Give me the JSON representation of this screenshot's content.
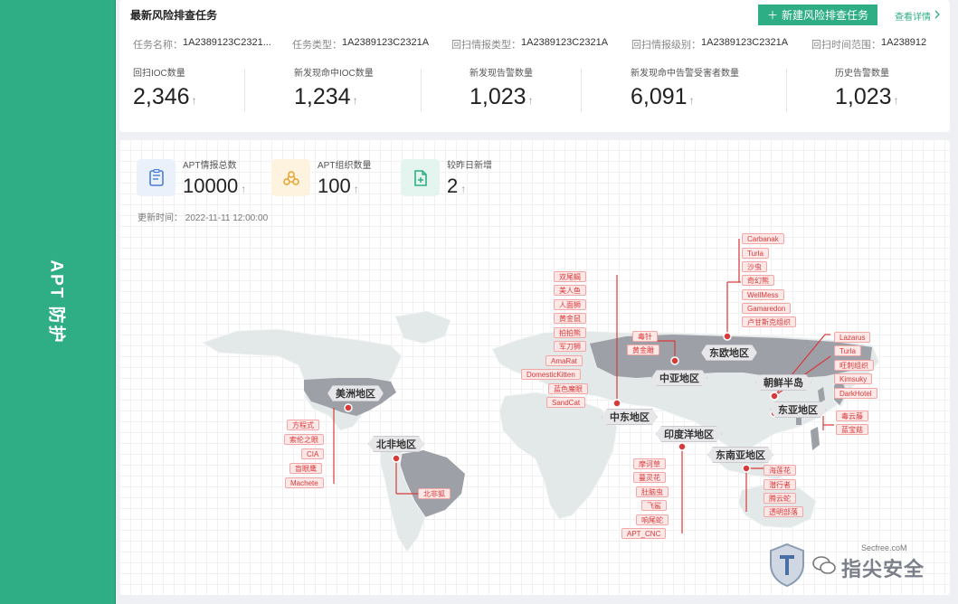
{
  "sidebar": {
    "title": "APT 防护"
  },
  "header": {
    "title": "最新风险排查任务",
    "new_task_button": "新建风险排查任务",
    "detail_link": "查看详情"
  },
  "meta": [
    {
      "k": "任务名称：",
      "v": "1A2389123C2321..."
    },
    {
      "k": "任务类型：",
      "v": "1A2389123C2321A"
    },
    {
      "k": "回扫情报类型：",
      "v": "1A2389123C2321A"
    },
    {
      "k": "回扫情报级别：",
      "v": "1A2389123C2321A"
    },
    {
      "k": "回扫时间范围：",
      "v": "1A238912"
    }
  ],
  "stats": [
    {
      "label": "回扫IOC数量",
      "value": "2,346"
    },
    {
      "label": "新发现命中IOC数量",
      "value": "1,234"
    },
    {
      "label": "新发现告警数量",
      "value": "1,023"
    },
    {
      "label": "新发现命中告警受害者数量",
      "value": "6,091"
    },
    {
      "label": "历史告警数量",
      "value": "1,023"
    }
  ],
  "kpis": [
    {
      "label": "APT情报总数",
      "value": "10000",
      "icon": "document-icon",
      "bg": "#eaf1fb",
      "color": "#4a7fd6"
    },
    {
      "label": "APT组织数量",
      "value": "100",
      "icon": "organization-icon",
      "bg": "#fdf3df",
      "color": "#e8a227"
    },
    {
      "label": "较昨日新增",
      "value": "2",
      "icon": "new-file-icon",
      "bg": "#e3f5ee",
      "color": "#2fae86"
    }
  ],
  "update_time": "更新时间：  2022-11-11   12:00:00",
  "arrow_glyph": "↑",
  "regions": {
    "americas": "美洲地区",
    "north_africa": "北非地区",
    "middle_east": "中东地区",
    "central_asia": "中亚地区",
    "eastern_europe": "东欧地区",
    "korea": "朝鲜半岛",
    "east_asia": "东亚地区",
    "indian_ocean": "印度洋地区",
    "southeast_asia": "东南亚地区"
  },
  "tags": {
    "americas": [
      "方程式",
      "索伦之眼",
      "CIA",
      "盲眼鹰",
      "Machete"
    ],
    "north_africa": [
      "北非狐"
    ],
    "middle_east": [
      "双尾蝎",
      "美人鱼",
      "人面狮",
      "黄金鼠",
      "拍拍熊",
      "军刀狮",
      "AmaRat",
      "DomesticKitten",
      "蓝色魔眼",
      "SandCat"
    ],
    "central_asia": [
      "毒针",
      "黄金雕"
    ],
    "eastern_europe": [
      "Carbanak",
      "Turla",
      "沙虫",
      "奇幻熊",
      "WellMess",
      "Gamaredon",
      "卢甘斯克组织"
    ],
    "korea": [
      "Lazarus",
      "Turla",
      "旺刺组织",
      "Kimsuky",
      "DarkHotel"
    ],
    "east_asia": [
      "毒云藤",
      "蓝宝菇"
    ],
    "indian_ocean": [
      "摩诃草",
      "蔓灵花",
      "肚脑虫",
      "飞鲨",
      "响尾蛇",
      "APT_CNC"
    ],
    "southeast_asia": [
      "海莲花",
      "潜行者",
      "腾云蛇",
      "透明部落"
    ]
  },
  "watermark": {
    "text": "指尖安全",
    "small": "Secfree.coM"
  },
  "colors": {
    "accent": "#2fae86",
    "tag_red": "#d83a3a",
    "land": "#e3e8e8",
    "highlight": "#9ea0a8"
  }
}
